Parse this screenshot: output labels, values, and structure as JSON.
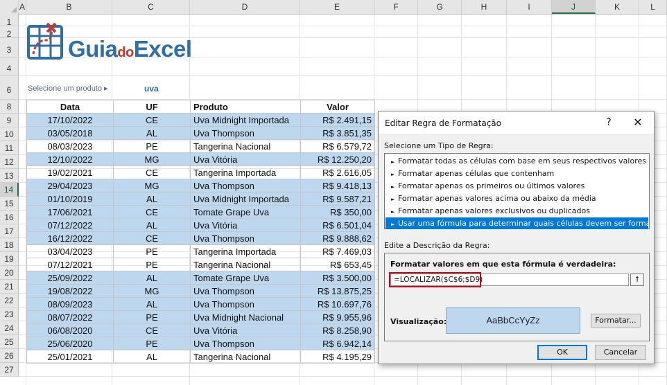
{
  "columns": [
    "A",
    "B",
    "C",
    "D",
    "E",
    "F",
    "G",
    "H",
    "I",
    "J",
    "K",
    "L"
  ],
  "selected_column": "J",
  "rows": [
    "1",
    "2",
    "3",
    "4",
    "6",
    "8",
    "9",
    "10",
    "11",
    "12",
    "13",
    "14",
    "15",
    "16",
    "17",
    "18",
    "19",
    "20",
    "21",
    "22",
    "23",
    "24",
    "25",
    "26",
    "27"
  ],
  "selected_row": "14",
  "logo": {
    "part1": "Guia",
    "part2": "do",
    "part3": "Excel",
    "icon": "spreadsheet-logo-icon"
  },
  "selector": {
    "label": "Selecione um produto ▸",
    "value": "uva"
  },
  "table": {
    "headers": [
      "Data",
      "UF",
      "Produto",
      "Valor"
    ],
    "rows": [
      {
        "data": "17/10/2022",
        "uf": "CE",
        "produto": "Uva Midnight Importada",
        "valor": "R$ 2.491,15",
        "hl": true
      },
      {
        "data": "03/05/2018",
        "uf": "AL",
        "produto": "Uva Thompson",
        "valor": "R$ 3.851,35",
        "hl": true
      },
      {
        "data": "08/03/2023",
        "uf": "PE",
        "produto": "Tangerina Nacional",
        "valor": "R$ 6.579,72",
        "hl": false
      },
      {
        "data": "12/10/2022",
        "uf": "MG",
        "produto": "Uva Vitória",
        "valor": "R$ 12.250,20",
        "hl": true
      },
      {
        "data": "19/02/2021",
        "uf": "CE",
        "produto": "Tangerina Importada",
        "valor": "R$ 2.616,05",
        "hl": false
      },
      {
        "data": "29/04/2023",
        "uf": "MG",
        "produto": "Uva Thompson",
        "valor": "R$ 9.418,13",
        "hl": true
      },
      {
        "data": "01/10/2019",
        "uf": "AL",
        "produto": "Uva Midnight Importada",
        "valor": "R$ 9.587,21",
        "hl": true
      },
      {
        "data": "17/06/2021",
        "uf": "CE",
        "produto": "Tomate Grape Uva",
        "valor": "R$ 350,00",
        "hl": true
      },
      {
        "data": "07/12/2022",
        "uf": "AL",
        "produto": "Uva Vitória",
        "valor": "R$ 6.501,04",
        "hl": true
      },
      {
        "data": "16/12/2022",
        "uf": "CE",
        "produto": "Uva Thompson",
        "valor": "R$ 9.888,62",
        "hl": true
      },
      {
        "data": "03/04/2023",
        "uf": "PE",
        "produto": "Tangerina Importada",
        "valor": "R$ 7.469,03",
        "hl": false
      },
      {
        "data": "07/12/2021",
        "uf": "PE",
        "produto": "Tangerina Nacional",
        "valor": "R$ 653,45",
        "hl": false
      },
      {
        "data": "25/09/2022",
        "uf": "AL",
        "produto": "Tomate Grape Uva",
        "valor": "R$ 3.500,00",
        "hl": true
      },
      {
        "data": "19/08/2022",
        "uf": "MG",
        "produto": "Uva Thompson",
        "valor": "R$ 13.875,25",
        "hl": true
      },
      {
        "data": "08/09/2023",
        "uf": "AL",
        "produto": "Uva Thompson",
        "valor": "R$ 10.697,76",
        "hl": true
      },
      {
        "data": "08/07/2022",
        "uf": "PE",
        "produto": "Uva Midnight Nacional",
        "valor": "R$ 9.955,96",
        "hl": true
      },
      {
        "data": "06/08/2020",
        "uf": "CE",
        "produto": "Uva Vitória",
        "valor": "R$ 8.258,90",
        "hl": true
      },
      {
        "data": "25/06/2020",
        "uf": "PE",
        "produto": "Uva Thompson",
        "valor": "R$ 6.942,14",
        "hl": true
      },
      {
        "data": "25/01/2021",
        "uf": "AL",
        "produto": "Tangerina Nacional",
        "valor": "R$ 4.195,29",
        "hl": false
      }
    ]
  },
  "dialog": {
    "title": "Editar Regra de Formatação",
    "help": "?",
    "close": "✕",
    "rule_type_label": "Selecione um Tipo de Regra:",
    "rule_types": [
      "Formatar todas as células com base em seus respectivos valores",
      "Formatar apenas células que contenham",
      "Formatar apenas os primeiros ou últimos valores",
      "Formatar apenas valores acima ou abaixo da média",
      "Formatar apenas valores exclusivos ou duplicados",
      "Usar uma fórmula para determinar quais células devem ser formatadas"
    ],
    "active_rule_index": 5,
    "desc_label": "Edite a Descrição da Regra:",
    "formula_label": "Formatar valores em que esta fórmula é verdadeira:",
    "formula_value": "=LOCALIZAR($C$6;$D9)",
    "collapse_icon": "⭡",
    "preview_label": "Visualização:",
    "preview_text": "AaBbCcYyZz",
    "format_button": "Formatar...",
    "ok_button": "OK",
    "cancel_button": "Cancelar"
  },
  "colors": {
    "highlight": "#bdd7ee",
    "accent": "#0078d7",
    "excel_green": "#217346",
    "annotation_red": "#d0021b"
  }
}
